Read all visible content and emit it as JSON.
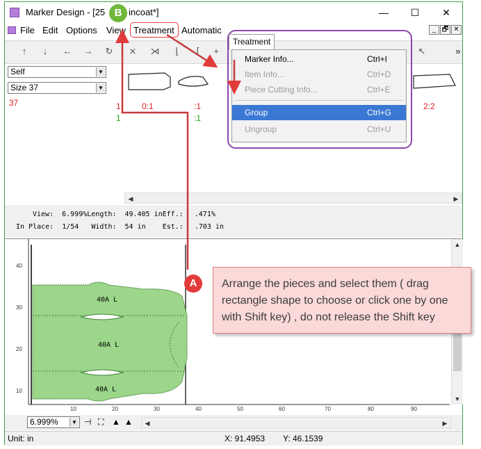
{
  "window": {
    "title": "Marker Design - [25",
    "title_tail": "incoat*]",
    "minimize": "—",
    "maximize": "☐",
    "close": "✕"
  },
  "menu": {
    "file": "File",
    "edit": "Edit",
    "options": "Options",
    "view": "View",
    "treatment": "Treatment",
    "automatic": "Automatic",
    "mdi_min": "_",
    "mdi_restore": "🗗",
    "mdi_close": "✕"
  },
  "toolbar": {
    "overflow": "»"
  },
  "selectors": {
    "style": "Self",
    "size": "Size 37"
  },
  "piece_labels": {
    "size_number": "37",
    "col1_red": "1",
    "col1_green": "1",
    "col2_red": "0:1",
    "col3_red": ":1",
    "col3_green": ":1",
    "right_red": "2:2"
  },
  "info": {
    "line1": "View:  6.999%Length:  49.405 inEff.: ",
    "line1_tail": ".471%",
    "line2": "In Place:  1/54   Width:  54 in    Est.: ",
    "line2_tail": ".703 in"
  },
  "dropdown": {
    "title": "Treatment",
    "items": [
      {
        "label": "Marker Info...",
        "shortcut": "Ctrl+I",
        "enabled": true,
        "selected": false
      },
      {
        "label": "Item Info...",
        "shortcut": "Ctrl+D",
        "enabled": false,
        "selected": false
      },
      {
        "label": "Piece Cutting Info...",
        "shortcut": "Ctrl+E",
        "enabled": false,
        "selected": false
      },
      {
        "label": "Group",
        "shortcut": "Ctrl+G",
        "enabled": true,
        "selected": true
      },
      {
        "label": "Ungroup",
        "shortcut": "Ctrl+U",
        "enabled": false,
        "selected": false
      }
    ]
  },
  "canvas": {
    "piece_labels": [
      "40A L",
      "40A L",
      "40A L"
    ],
    "y_ticks": [
      "40",
      "30",
      "20",
      "10"
    ],
    "x_ticks": [
      "10",
      "20",
      "30",
      "40",
      "50",
      "60",
      "70",
      "80",
      "90"
    ]
  },
  "zoom": "6.999%",
  "status": {
    "unit": "Unit: in",
    "x": "X: 91.4953",
    "y": "Y: 46.1539"
  },
  "annotation": {
    "badge_a": "A",
    "badge_b": "B",
    "callout": "Arrange the pieces and select them ( drag rectangle shape to choose or click one by one with Shift key) , do not release the Shift key"
  },
  "colors": {
    "piece_fill": "#9bd68a",
    "highlight": "#3a78d4",
    "outline_purple": "#8e44ad",
    "annotation_red": "#e23b3b",
    "badge_green": "#6fb83c"
  }
}
